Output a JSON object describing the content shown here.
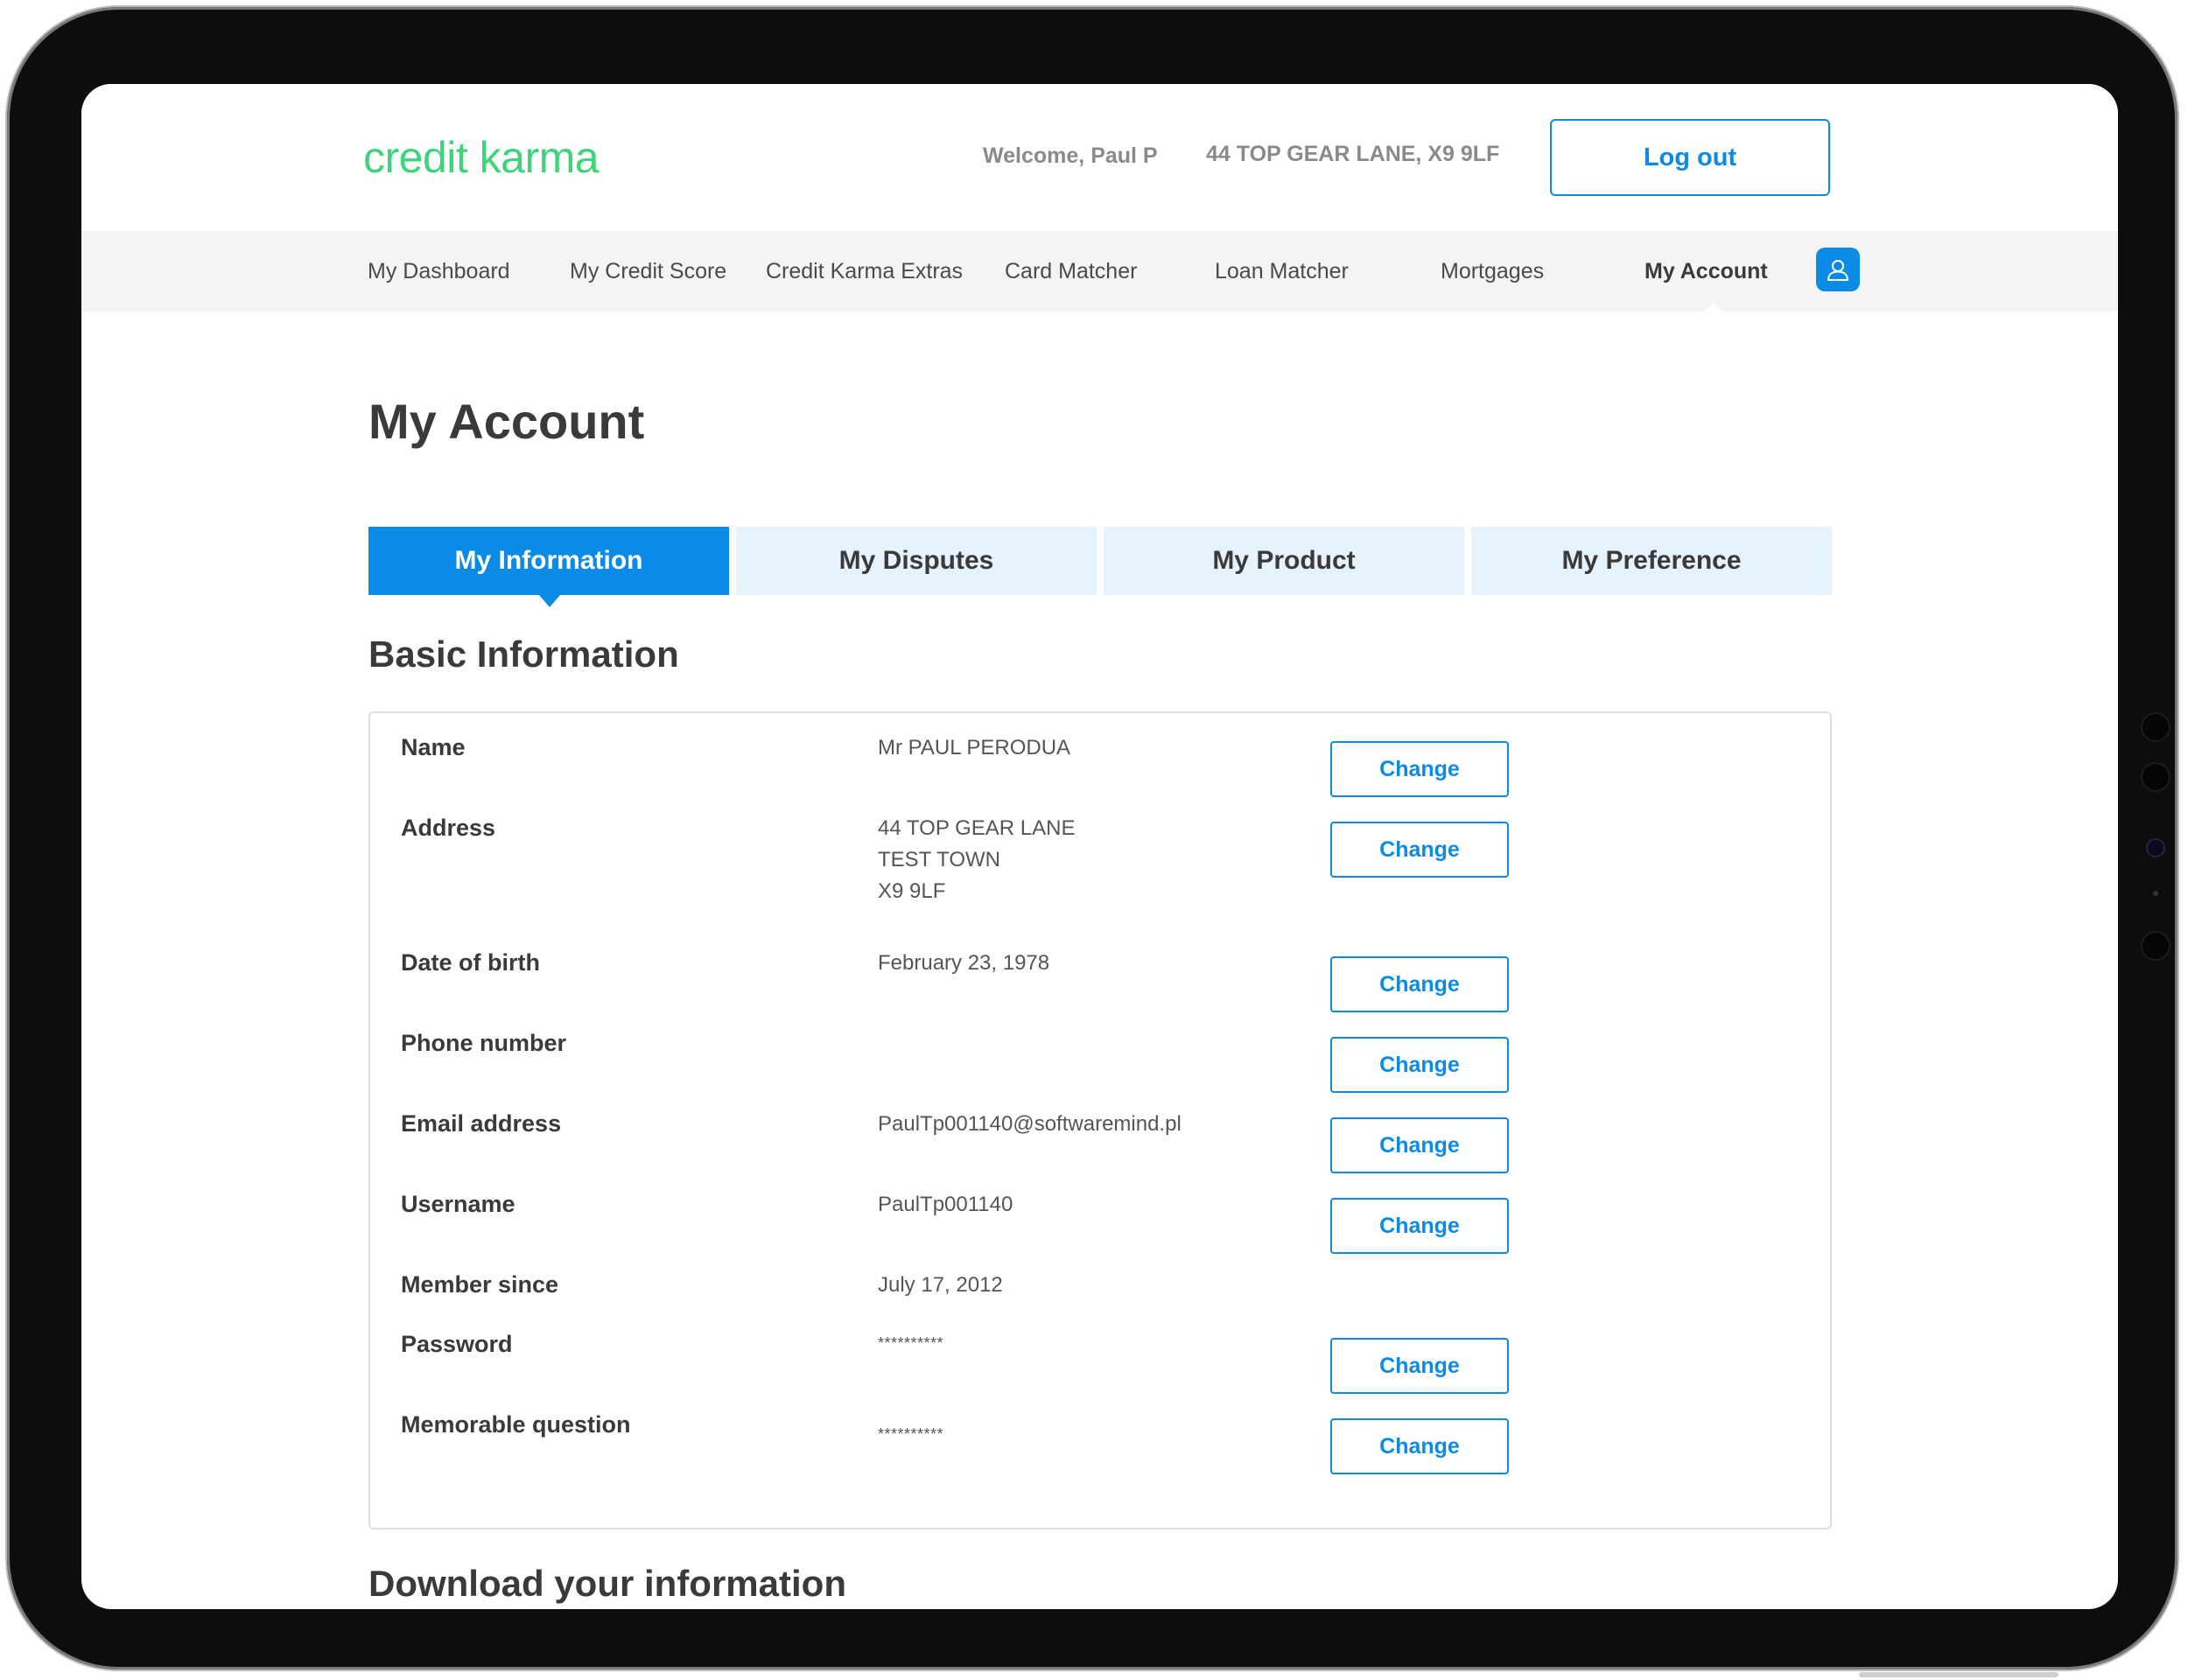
{
  "header": {
    "logo": "credit karma",
    "welcome": "Welcome, Paul P",
    "address": "44 TOP GEAR LANE, X9 9LF",
    "logout_label": "Log out"
  },
  "nav": {
    "items": [
      {
        "label": "My Dashboard"
      },
      {
        "label": "My Credit Score"
      },
      {
        "label": "Credit Karma Extras"
      },
      {
        "label": "Card Matcher"
      },
      {
        "label": "Loan Matcher"
      },
      {
        "label": "Mortgages"
      },
      {
        "label": "My Account",
        "active": true
      }
    ],
    "avatar_icon": "user-icon"
  },
  "page": {
    "title": "My Account",
    "tabs": [
      {
        "label": "My Information",
        "active": true
      },
      {
        "label": "My Disputes"
      },
      {
        "label": "My Product"
      },
      {
        "label": "My Preference"
      }
    ],
    "section_title": "Basic Information",
    "download_title": "Download your information"
  },
  "info": {
    "change_label": "Change",
    "rows": [
      {
        "label": "Name",
        "value": "Mr PAUL PERODUA"
      },
      {
        "label": "Address",
        "value": "44 TOP GEAR LANE\nTEST TOWN\nX9 9LF"
      },
      {
        "label": "Date of birth",
        "value": "February 23, 1978"
      },
      {
        "label": "Phone number",
        "value": ""
      },
      {
        "label": "Email address",
        "value": "PaulTp001140@softwaremind.pl"
      },
      {
        "label": "Username",
        "value": "PaulTp001140"
      },
      {
        "label": "Member since",
        "value": "July 17, 2012"
      },
      {
        "label": "Password",
        "value": "**********"
      },
      {
        "label": "Memorable question",
        "value": "**********"
      }
    ]
  },
  "colors": {
    "brand_green": "#3fd47c",
    "accent_blue": "#0b8be5",
    "tab_inactive": "#e6f3fd"
  }
}
